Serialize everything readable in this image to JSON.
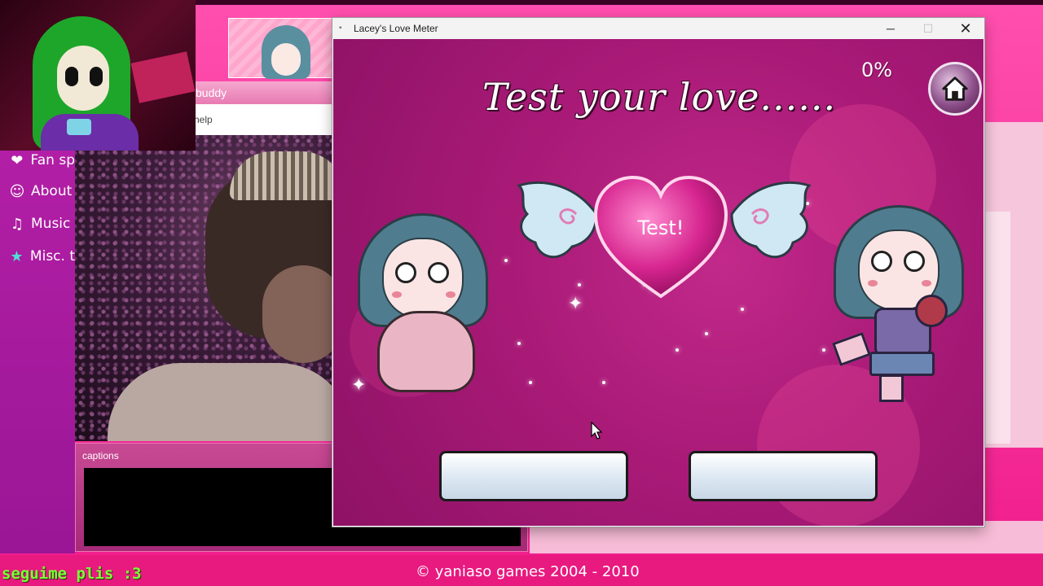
{
  "background": {
    "sidebar": [
      {
        "label": "Fan sp",
        "icon": "fan-icon"
      },
      {
        "label": "About",
        "icon": "smiley-icon"
      },
      {
        "label": "Music",
        "icon": "music-icon"
      },
      {
        "label": "Misc. t",
        "icon": "star-icon"
      }
    ],
    "buddy_window": {
      "title": "buddy",
      "menu": "help"
    },
    "captions_title": "captions",
    "footer": "© yaniaso games 2004 - 2010",
    "stream_tag": "seguime plis :3"
  },
  "app": {
    "title": "Lacey's Love Meter",
    "controls": {
      "minimize": "─",
      "maximize": "☐",
      "close": "✕"
    }
  },
  "game": {
    "headline": "Test your love......",
    "percent": "0%",
    "heart_button": "Test!",
    "answer_left": "",
    "answer_right": "",
    "colors": {
      "bg": "#a91a77",
      "heart": "#d6258f",
      "button": "#dbe7f2"
    }
  }
}
